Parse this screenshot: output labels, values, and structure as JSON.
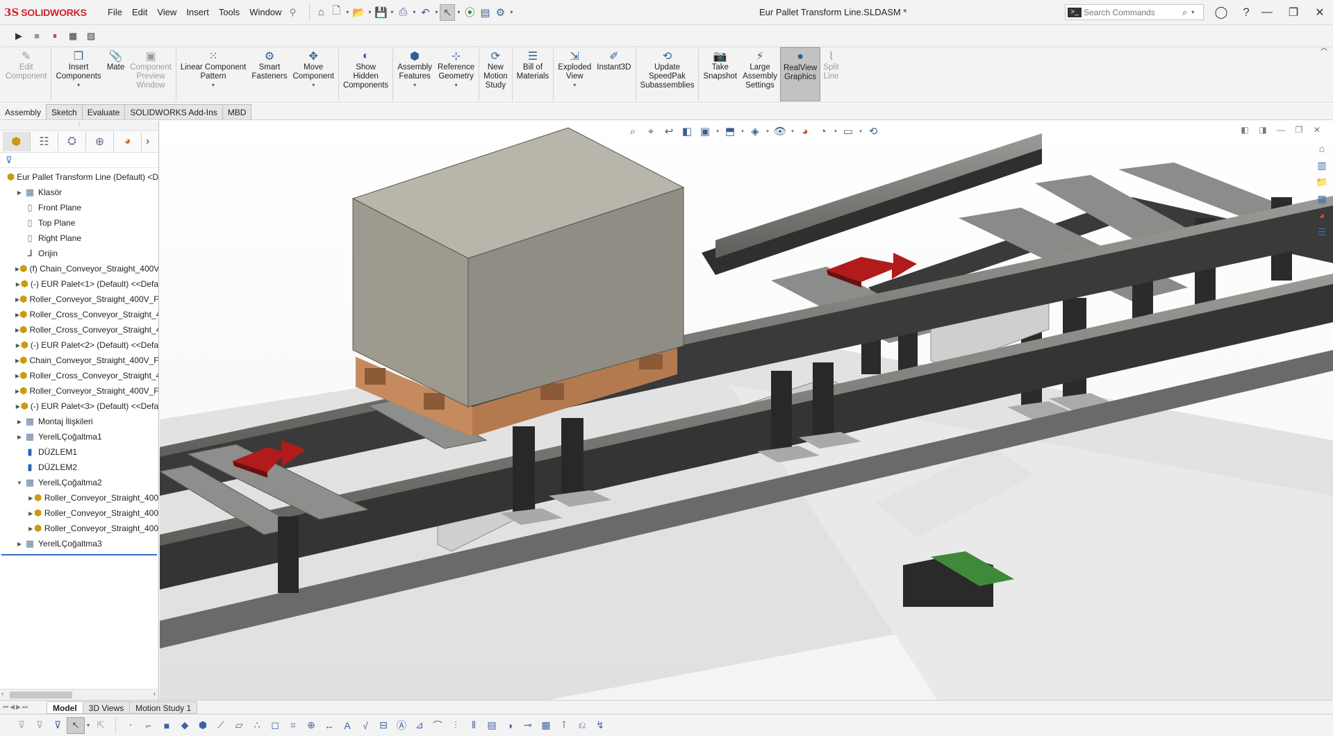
{
  "app": {
    "logo_mark": "3S",
    "logo_text": "SOLIDWORKS",
    "document_title": "Eur Pallet Transform Line.SLDASM *"
  },
  "menus": [
    "File",
    "Edit",
    "View",
    "Insert",
    "Tools",
    "Window"
  ],
  "search": {
    "placeholder": "Search Commands"
  },
  "command_manager": [
    {
      "label": "Edit\nComponent",
      "icon": "edit-component-icon",
      "glyph": "✎",
      "disabled": true,
      "dropdown": false
    },
    {
      "label": "Insert\nComponents",
      "icon": "insert-components-icon",
      "glyph": "❐",
      "disabled": false,
      "dropdown": true
    },
    {
      "label": "Mate",
      "icon": "mate-icon",
      "glyph": "📎",
      "disabled": false,
      "dropdown": false
    },
    {
      "label": "Component\nPreview\nWindow",
      "icon": "preview-window-icon",
      "glyph": "▣",
      "disabled": true,
      "dropdown": false
    },
    {
      "label": "Linear Component\nPattern",
      "icon": "linear-pattern-icon",
      "glyph": "⁙",
      "disabled": false,
      "dropdown": true
    },
    {
      "label": "Smart\nFasteners",
      "icon": "smart-fasteners-icon",
      "glyph": "⚙",
      "disabled": false,
      "dropdown": false
    },
    {
      "label": "Move\nComponent",
      "icon": "move-component-icon",
      "glyph": "✥",
      "disabled": false,
      "dropdown": true
    },
    {
      "label": "Show\nHidden\nComponents",
      "icon": "show-hidden-icon",
      "glyph": "◐",
      "disabled": false,
      "dropdown": false
    },
    {
      "label": "Assembly\nFeatures",
      "icon": "assembly-features-icon",
      "glyph": "⬢",
      "disabled": false,
      "dropdown": true
    },
    {
      "label": "Reference\nGeometry",
      "icon": "reference-geometry-icon",
      "glyph": "⊹",
      "disabled": false,
      "dropdown": true
    },
    {
      "label": "New\nMotion\nStudy",
      "icon": "motion-study-icon",
      "glyph": "⟳",
      "disabled": false,
      "dropdown": false
    },
    {
      "label": "Bill of\nMaterials",
      "icon": "bom-icon",
      "glyph": "☰",
      "disabled": false,
      "dropdown": false
    },
    {
      "label": "Exploded\nView",
      "icon": "exploded-view-icon",
      "glyph": "⇲",
      "disabled": false,
      "dropdown": true
    },
    {
      "label": "Instant3D",
      "icon": "instant3d-icon",
      "glyph": "✐",
      "disabled": false,
      "dropdown": false
    },
    {
      "label": "Update\nSpeedPak\nSubassemblies",
      "icon": "speedpak-icon",
      "glyph": "⟲",
      "disabled": false,
      "dropdown": false
    },
    {
      "label": "Take\nSnapshot",
      "icon": "snapshot-icon",
      "glyph": "📷",
      "disabled": false,
      "dropdown": false
    },
    {
      "label": "Large\nAssembly\nSettings",
      "icon": "large-assembly-icon",
      "glyph": "⚡",
      "disabled": false,
      "dropdown": false
    },
    {
      "label": "RealView\nGraphics",
      "icon": "realview-icon",
      "glyph": "●",
      "disabled": false,
      "dropdown": false,
      "active": true
    },
    {
      "label": "Split\nLine",
      "icon": "split-line-icon",
      "glyph": "⌇",
      "disabled": true,
      "dropdown": false
    }
  ],
  "tabs": [
    "Assembly",
    "Sketch",
    "Evaluate",
    "SOLIDWORKS Add-Ins",
    "MBD"
  ],
  "active_tab": "Assembly",
  "feature_tree": [
    {
      "label": "Eur Pallet Transform Line (Default) <D",
      "icon": "assembly-icon",
      "kind": "asm",
      "indent": 0,
      "expand": ""
    },
    {
      "label": "Klasör",
      "icon": "folder-icon",
      "kind": "folder",
      "indent": 1,
      "expand": "right"
    },
    {
      "label": "Front Plane",
      "icon": "plane-icon",
      "kind": "plane",
      "indent": 1,
      "expand": ""
    },
    {
      "label": "Top Plane",
      "icon": "plane-icon",
      "kind": "plane",
      "indent": 1,
      "expand": ""
    },
    {
      "label": "Right Plane",
      "icon": "plane-icon",
      "kind": "plane",
      "indent": 1,
      "expand": ""
    },
    {
      "label": "Orijin",
      "icon": "origin-icon",
      "kind": "orig",
      "indent": 1,
      "expand": ""
    },
    {
      "label": "(f) Chain_Conveyor_Straight_400V",
      "icon": "assembly-icon",
      "kind": "asm",
      "indent": 1,
      "expand": "right"
    },
    {
      "label": "(-) EUR Palet<1> (Default) <<Defa",
      "icon": "assembly-icon",
      "kind": "asm",
      "indent": 1,
      "expand": "right"
    },
    {
      "label": "Roller_Conveyor_Straight_400V_Fl",
      "icon": "assembly-icon",
      "kind": "asm",
      "indent": 1,
      "expand": "right"
    },
    {
      "label": "Roller_Cross_Conveyor_Straight_4",
      "icon": "assembly-icon",
      "kind": "asm",
      "indent": 1,
      "expand": "right"
    },
    {
      "label": "Roller_Cross_Conveyor_Straight_4",
      "icon": "assembly-icon",
      "kind": "asm",
      "indent": 1,
      "expand": "right"
    },
    {
      "label": "(-) EUR Palet<2> (Default) <<Defa",
      "icon": "assembly-icon",
      "kind": "asm",
      "indent": 1,
      "expand": "right"
    },
    {
      "label": "Chain_Conveyor_Straight_400V_Fl",
      "icon": "assembly-icon",
      "kind": "asm",
      "indent": 1,
      "expand": "right"
    },
    {
      "label": "Roller_Cross_Conveyor_Straight_4",
      "icon": "assembly-icon",
      "kind": "asm",
      "indent": 1,
      "expand": "right"
    },
    {
      "label": "Roller_Conveyor_Straight_400V_Fl",
      "icon": "assembly-icon",
      "kind": "asm",
      "indent": 1,
      "expand": "right"
    },
    {
      "label": "(-) EUR Palet<3> (Default) <<Defa",
      "icon": "assembly-icon",
      "kind": "asm",
      "indent": 1,
      "expand": "right"
    },
    {
      "label": "Montaj İlişkileri",
      "icon": "mates-folder-icon",
      "kind": "folder",
      "indent": 1,
      "expand": "right"
    },
    {
      "label": "YerelLÇoğaltma1",
      "icon": "pattern-icon",
      "kind": "folder",
      "indent": 1,
      "expand": "right"
    },
    {
      "label": "DÜZLEM1",
      "icon": "plane-icon",
      "kind": "plane2",
      "indent": 1,
      "expand": ""
    },
    {
      "label": "DÜZLEM2",
      "icon": "plane-icon",
      "kind": "plane2",
      "indent": 1,
      "expand": ""
    },
    {
      "label": "YerelLÇoğaltma2",
      "icon": "pattern-icon",
      "kind": "folder",
      "indent": 1,
      "expand": "down"
    },
    {
      "label": "Roller_Conveyor_Straight_400",
      "icon": "assembly-icon",
      "kind": "asm",
      "indent": 2,
      "expand": "right"
    },
    {
      "label": "Roller_Conveyor_Straight_400",
      "icon": "assembly-icon",
      "kind": "asm",
      "indent": 2,
      "expand": "right"
    },
    {
      "label": "Roller_Conveyor_Straight_400",
      "icon": "assembly-icon",
      "kind": "asm",
      "indent": 2,
      "expand": "right"
    },
    {
      "label": "YerelLÇoğaltma3",
      "icon": "pattern-icon",
      "kind": "folder",
      "indent": 1,
      "expand": "right"
    }
  ],
  "bottom_tabs": [
    "Model",
    "3D Views",
    "Motion Study 1"
  ],
  "active_bottom_tab": "Model"
}
